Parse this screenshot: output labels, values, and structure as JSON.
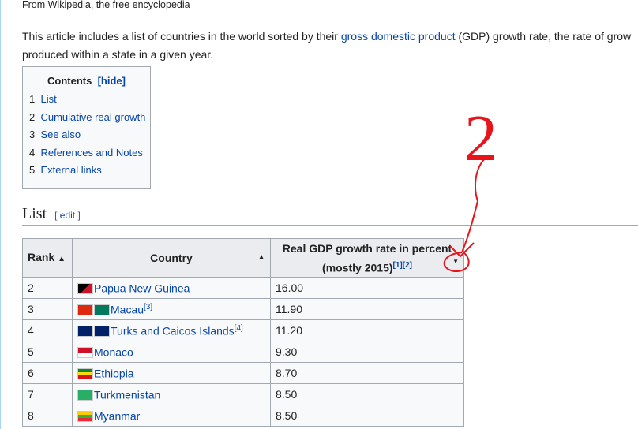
{
  "subtitle": "From Wikipedia, the free encyclopedia",
  "intro": {
    "before": "This article includes a list of countries in the world sorted by their ",
    "link": "gross domestic product",
    "after": " (GDP) growth rate, the rate of grow",
    "line2": "produced within a state in a given year."
  },
  "toc": {
    "title": "Contents",
    "hide": "[hide]",
    "items": [
      {
        "n": "1",
        "label": "List"
      },
      {
        "n": "2",
        "label": "Cumulative real growth"
      },
      {
        "n": "3",
        "label": "See also"
      },
      {
        "n": "4",
        "label": "References and Notes"
      },
      {
        "n": "5",
        "label": "External links"
      }
    ]
  },
  "section": {
    "title": "List",
    "edit_open": "[ ",
    "edit": "edit",
    "edit_close": " ]"
  },
  "table": {
    "headers": {
      "rank": "Rank",
      "country": "Country",
      "gdp1": "Real GDP growth rate in percent",
      "gdp2": "(mostly 2015)",
      "gdp_refs": "[1][2]"
    },
    "rows": [
      {
        "rank": "2",
        "country": "Papua New Guinea",
        "ref": "",
        "value": "16.00"
      },
      {
        "rank": "3",
        "country": "Macau",
        "ref": "[3]",
        "value": "11.90"
      },
      {
        "rank": "4",
        "country": "Turks and Caicos Islands",
        "ref": "[4]",
        "value": "11.20"
      },
      {
        "rank": "5",
        "country": "Monaco",
        "ref": "",
        "value": "9.30"
      },
      {
        "rank": "6",
        "country": "Ethiopia",
        "ref": "",
        "value": "8.70"
      },
      {
        "rank": "7",
        "country": "Turkmenistan",
        "ref": "",
        "value": "8.50"
      },
      {
        "rank": "8",
        "country": "Myanmar",
        "ref": "",
        "value": "8.50"
      }
    ]
  },
  "annotation": {
    "label": "2",
    "color": "#e8141c"
  }
}
